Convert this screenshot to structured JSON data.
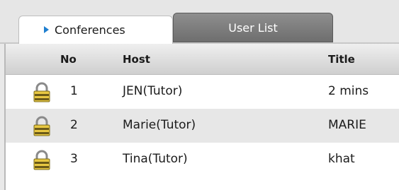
{
  "tabs": [
    {
      "label": "Conferences",
      "active": true
    },
    {
      "label": "User List",
      "active": false
    }
  ],
  "table": {
    "columns": [
      "No",
      "Host",
      "Title"
    ],
    "rows": [
      {
        "no": "1",
        "host": "JEN(Tutor)",
        "title": "2 mins",
        "icon": "lock-icon"
      },
      {
        "no": "2",
        "host": "Marie(Tutor)",
        "title": "MARIE",
        "icon": "lock-icon"
      },
      {
        "no": "3",
        "host": "Tina(Tutor)",
        "title": "khat",
        "icon": "lock-icon"
      }
    ]
  },
  "colors": {
    "active_tab": "#ffffff",
    "inactive_tab": "#7a7a7a",
    "arrow": "#1f7fd0",
    "alt_row": "#e7e7e7"
  }
}
